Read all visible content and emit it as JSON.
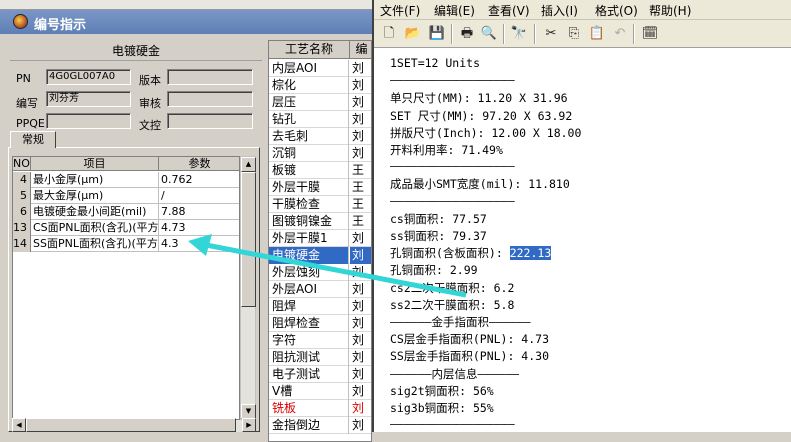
{
  "colors": {
    "accent": "#316ac5",
    "arrow": "#33d6d6",
    "red_text": "#e00000"
  },
  "left_window": {
    "title": "编号指示",
    "panel_title": "电镀硬金",
    "fields": {
      "pn_label": "PN",
      "pn_value": "4G0GL007A0",
      "author_label": "编写",
      "author_value": "刘芬芳",
      "ppqe_label": "PPQE",
      "ppqe_value": "",
      "version_label": "版本",
      "version_value": "",
      "review_label": "审核",
      "review_value": "",
      "control_label": "文控",
      "control_value": ""
    },
    "tab_label": "常规",
    "table": {
      "headers": [
        "NO",
        "项目",
        "参数"
      ],
      "rows": [
        {
          "no": "4",
          "item": "最小金厚(μm)",
          "param": "0.762"
        },
        {
          "no": "5",
          "item": "最大金厚(μm)",
          "param": "/"
        },
        {
          "no": "6",
          "item": "电镀硬金最小间距(mil)",
          "param": "7.88"
        },
        {
          "no": "13",
          "item": "CS面PNL面积(含孔)(平方",
          "param": "4.73"
        },
        {
          "no": "14",
          "item": "SS面PNL面积(含孔)(平方",
          "param": "4.3"
        }
      ]
    }
  },
  "process_list": {
    "headers": [
      "工艺名称",
      "编"
    ],
    "rows": [
      {
        "name": "内层AOI",
        "owner": "刘"
      },
      {
        "name": "棕化",
        "owner": "刘"
      },
      {
        "name": "层压",
        "owner": "刘"
      },
      {
        "name": "钻孔",
        "owner": "刘"
      },
      {
        "name": "去毛刺",
        "owner": "刘"
      },
      {
        "name": "沉铜",
        "owner": "刘"
      },
      {
        "name": "板镀",
        "owner": "王"
      },
      {
        "name": "外层干膜",
        "owner": "王"
      },
      {
        "name": "干膜检查",
        "owner": "王"
      },
      {
        "name": "图镀铜镍金",
        "owner": "王"
      },
      {
        "name": "外层干膜1",
        "owner": "刘"
      },
      {
        "name": "电镀硬金",
        "owner": "刘"
      },
      {
        "name": "外层蚀刻",
        "owner": "刘"
      },
      {
        "name": "外层AOI",
        "owner": "刘"
      },
      {
        "name": "阻焊",
        "owner": "刘"
      },
      {
        "name": "阻焊检查",
        "owner": "刘"
      },
      {
        "name": "字符",
        "owner": "刘"
      },
      {
        "name": "阻抗测试",
        "owner": "刘"
      },
      {
        "name": "电子测试",
        "owner": "刘"
      },
      {
        "name": "V槽",
        "owner": "刘"
      },
      {
        "name": "铣板",
        "owner": "刘"
      },
      {
        "name": "金指倒边",
        "owner": "刘"
      }
    ]
  },
  "notepad": {
    "menu": [
      "文件(F)",
      "编辑(E)",
      "查看(V)",
      "插入(I)",
      "格式(O)",
      "帮助(H)"
    ],
    "lines": [
      "1SET=12 Units",
      "——————————————————",
      "单只尺寸(MM): 11.20 X 31.96",
      "SET 尺寸(MM): 97.20 X 63.92",
      "拼版尺寸(Inch): 12.00 X 18.00",
      "开料利用率: 71.49%",
      "——————————————————",
      "成品最小SMT宽度(mil): 11.810",
      "——————————————————",
      "cs铜面积: 77.57",
      "ss铜面积: 79.37",
      "孔铜面积(含板面积): ",
      "孔铜面积: 2.99",
      "cs2二次干膜面积: 6.2",
      "ss2二次干膜面积: 5.8",
      "——————金手指面积——————",
      "CS层金手指面积(PNL): 4.73",
      "SS层金手指面积(PNL): 4.30",
      "——————内层信息——————",
      "sig2t铜面积: 56%",
      "sig3b铜面积: 55%",
      "——————————————————"
    ],
    "highlight_value": "222.13"
  }
}
